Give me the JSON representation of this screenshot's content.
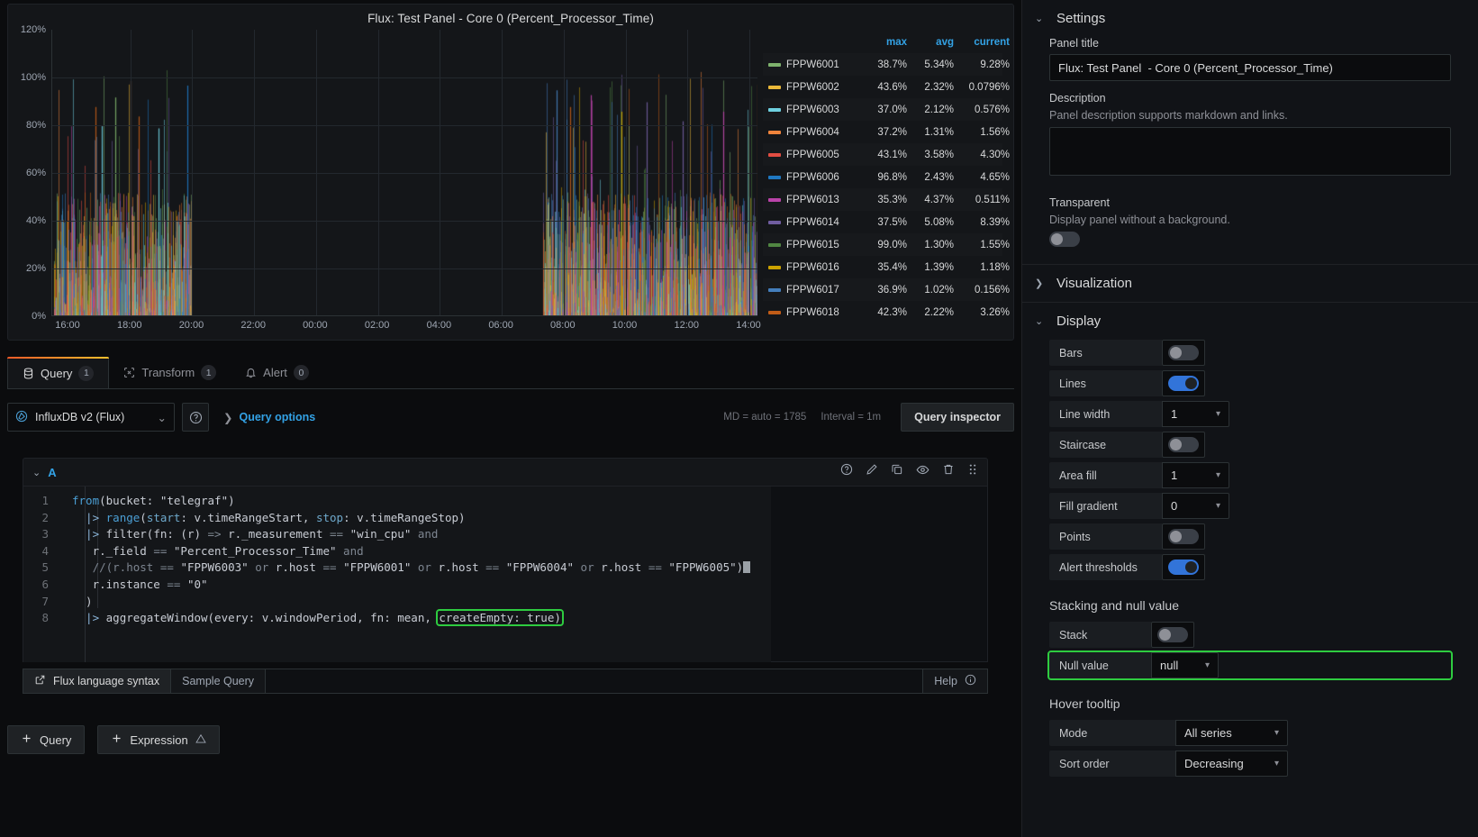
{
  "panel": {
    "title": "Flux: Test Panel - Core 0 (Percent_Processor_Time)",
    "y_ticks": [
      "120%",
      "100%",
      "80%",
      "60%",
      "40%",
      "20%",
      "0%"
    ],
    "x_ticks": [
      "16:00",
      "18:00",
      "20:00",
      "22:00",
      "00:00",
      "02:00",
      "04:00",
      "06:00",
      "08:00",
      "10:00",
      "12:00",
      "14:00"
    ]
  },
  "legend": {
    "columns": [
      "max",
      "avg",
      "current"
    ],
    "rows": [
      {
        "name": "FPPW6001",
        "color": "#7eb26d",
        "max": "38.7%",
        "avg": "5.34%",
        "current": "9.28%"
      },
      {
        "name": "FPPW6002",
        "color": "#eab839",
        "max": "43.6%",
        "avg": "2.32%",
        "current": "0.0796%"
      },
      {
        "name": "FPPW6003",
        "color": "#6ed0e0",
        "max": "37.0%",
        "avg": "2.12%",
        "current": "0.576%"
      },
      {
        "name": "FPPW6004",
        "color": "#ef843c",
        "max": "37.2%",
        "avg": "1.31%",
        "current": "1.56%"
      },
      {
        "name": "FPPW6005",
        "color": "#e24d42",
        "max": "43.1%",
        "avg": "3.58%",
        "current": "4.30%"
      },
      {
        "name": "FPPW6006",
        "color": "#1f78c1",
        "max": "96.8%",
        "avg": "2.43%",
        "current": "4.65%"
      },
      {
        "name": "FPPW6013",
        "color": "#ba43a9",
        "max": "35.3%",
        "avg": "4.37%",
        "current": "0.511%"
      },
      {
        "name": "FPPW6014",
        "color": "#705da0",
        "max": "37.5%",
        "avg": "5.08%",
        "current": "8.39%"
      },
      {
        "name": "FPPW6015",
        "color": "#508642",
        "max": "99.0%",
        "avg": "1.30%",
        "current": "1.55%"
      },
      {
        "name": "FPPW6016",
        "color": "#cca300",
        "max": "35.4%",
        "avg": "1.39%",
        "current": "1.18%"
      },
      {
        "name": "FPPW6017",
        "color": "#447ebc",
        "max": "36.9%",
        "avg": "1.02%",
        "current": "0.156%"
      },
      {
        "name": "FPPW6018",
        "color": "#c15c17",
        "max": "42.3%",
        "avg": "2.22%",
        "current": "3.26%"
      }
    ]
  },
  "tabs": [
    {
      "label": "Query",
      "badge": "1",
      "icon": "database-icon",
      "active": true
    },
    {
      "label": "Transform",
      "badge": "1",
      "icon": "transform-icon",
      "active": false
    },
    {
      "label": "Alert",
      "badge": "0",
      "icon": "bell-icon",
      "active": false
    }
  ],
  "query_bar": {
    "datasource": "InfluxDB v2 (Flux)",
    "query_options": "Query options",
    "md_info": "MD = auto = 1785",
    "interval_info": "Interval = 1m",
    "query_inspector": "Query inspector"
  },
  "query_row": {
    "id": "A"
  },
  "code": {
    "lines": [
      {
        "n": "1",
        "tokens": [
          {
            "t": "from",
            "c": "tok-fn"
          },
          {
            "t": "(bucket: ",
            "c": "tok-pln"
          },
          {
            "t": "\"telegraf\"",
            "c": "tok-str"
          },
          {
            "t": ")",
            "c": "tok-pln"
          }
        ]
      },
      {
        "n": "2",
        "tokens": [
          {
            "t": "  |> ",
            "c": "tok-pipe"
          },
          {
            "t": "range",
            "c": "tok-fn"
          },
          {
            "t": "(",
            "c": "tok-pln"
          },
          {
            "t": "start",
            "c": "tok-arg"
          },
          {
            "t": ": v.timeRangeStart, ",
            "c": "tok-pln"
          },
          {
            "t": "stop",
            "c": "tok-arg"
          },
          {
            "t": ": v.timeRangeStop)",
            "c": "tok-pln"
          }
        ]
      },
      {
        "n": "3",
        "tokens": [
          {
            "t": "  |> ",
            "c": "tok-pipe"
          },
          {
            "t": "filter",
            "c": "tok-pln"
          },
          {
            "t": "(fn: (r) ",
            "c": "tok-pln"
          },
          {
            "t": "=>",
            "c": "tok-op"
          },
          {
            "t": " r._measurement ",
            "c": "tok-pln"
          },
          {
            "t": "==",
            "c": "tok-op"
          },
          {
            "t": " ",
            "c": "tok-pln"
          },
          {
            "t": "\"win_cpu\"",
            "c": "tok-str"
          },
          {
            "t": " and",
            "c": "tok-op"
          }
        ]
      },
      {
        "n": "4",
        "tokens": [
          {
            "t": "   r._field ",
            "c": "tok-pln"
          },
          {
            "t": "==",
            "c": "tok-op"
          },
          {
            "t": " ",
            "c": "tok-pln"
          },
          {
            "t": "\"Percent_Processor_Time\"",
            "c": "tok-str"
          },
          {
            "t": " and",
            "c": "tok-op"
          }
        ]
      },
      {
        "n": "5",
        "tokens": [
          {
            "t": "   //(r.host ",
            "c": "tok-com"
          },
          {
            "t": "==",
            "c": "tok-op"
          },
          {
            "t": " ",
            "c": "tok-pln"
          },
          {
            "t": "\"FPPW6003\"",
            "c": "tok-str"
          },
          {
            "t": " or",
            "c": "tok-op"
          },
          {
            "t": " r.host ",
            "c": "tok-pln"
          },
          {
            "t": "==",
            "c": "tok-op"
          },
          {
            "t": " ",
            "c": "tok-pln"
          },
          {
            "t": "\"FPPW6001\"",
            "c": "tok-str"
          },
          {
            "t": " or",
            "c": "tok-op"
          },
          {
            "t": " r.host ",
            "c": "tok-pln"
          },
          {
            "t": "==",
            "c": "tok-op"
          },
          {
            "t": " ",
            "c": "tok-pln"
          },
          {
            "t": "\"FPPW6004\"",
            "c": "tok-str"
          },
          {
            "t": " or",
            "c": "tok-op"
          },
          {
            "t": " r.host ",
            "c": "tok-pln"
          },
          {
            "t": "==",
            "c": "tok-op"
          },
          {
            "t": " ",
            "c": "tok-pln"
          },
          {
            "t": "\"FPPW6005\"",
            "c": "tok-str"
          },
          {
            "t": ")",
            "c": "tok-pln"
          }
        ]
      },
      {
        "n": "6",
        "tokens": [
          {
            "t": "   r.instance ",
            "c": "tok-pln"
          },
          {
            "t": "==",
            "c": "tok-op"
          },
          {
            "t": " ",
            "c": "tok-pln"
          },
          {
            "t": "\"0\"",
            "c": "tok-str"
          }
        ]
      },
      {
        "n": "7",
        "tokens": [
          {
            "t": "  )",
            "c": "tok-pln"
          }
        ]
      },
      {
        "n": "8",
        "tokens": [
          {
            "t": "  |> ",
            "c": "tok-pipe"
          },
          {
            "t": "aggregateWindow",
            "c": "tok-pln"
          },
          {
            "t": "(every: v.windowPeriod, fn: mean, ",
            "c": "tok-pln"
          }
        ],
        "highlight": "createEmpty: true)"
      }
    ]
  },
  "editor_footer": {
    "syntax_link": "Flux language syntax",
    "sample_query": "Sample Query",
    "help": "Help"
  },
  "bottom_buttons": [
    {
      "label": "Query",
      "icon": "plus-icon"
    },
    {
      "label": "Expression",
      "icon": "plus-icon",
      "warn": true
    }
  ],
  "options": {
    "settings": {
      "header": "Settings",
      "panel_title_label": "Panel title",
      "panel_title_value": "Flux: Test Panel  - Core 0 (Percent_Processor_Time)",
      "description_label": "Description",
      "description_sub": "Panel description supports markdown and links.",
      "description_value": "",
      "transparent_label": "Transparent",
      "transparent_sub": "Display panel without a background.",
      "transparent_on": false
    },
    "visualization": {
      "header": "Visualization"
    },
    "display": {
      "header": "Display",
      "rows": [
        {
          "label": "Bars",
          "type": "toggle",
          "on": false
        },
        {
          "label": "Lines",
          "type": "toggle",
          "on": true
        },
        {
          "label": "Line width",
          "type": "select",
          "value": "1"
        },
        {
          "label": "Staircase",
          "type": "toggle",
          "on": false
        },
        {
          "label": "Area fill",
          "type": "select",
          "value": "1"
        },
        {
          "label": "Fill gradient",
          "type": "select",
          "value": "0"
        },
        {
          "label": "Points",
          "type": "toggle",
          "on": false
        },
        {
          "label": "Alert thresholds",
          "type": "toggle",
          "on": true
        }
      ],
      "stacking_title": "Stacking and null value",
      "stacking_rows": [
        {
          "label": "Stack",
          "type": "toggle",
          "on": false
        },
        {
          "label": "Null value",
          "type": "select",
          "value": "null",
          "highlighted": true
        }
      ],
      "tooltip_title": "Hover tooltip",
      "tooltip_rows": [
        {
          "label": "Mode",
          "type": "select",
          "value": "All series"
        },
        {
          "label": "Sort order",
          "type": "select",
          "value": "Decreasing"
        }
      ]
    }
  },
  "colors": {
    "accent": "#33a2e5",
    "toggle_on": "#3274d9",
    "highlight": "#2ecc40"
  }
}
